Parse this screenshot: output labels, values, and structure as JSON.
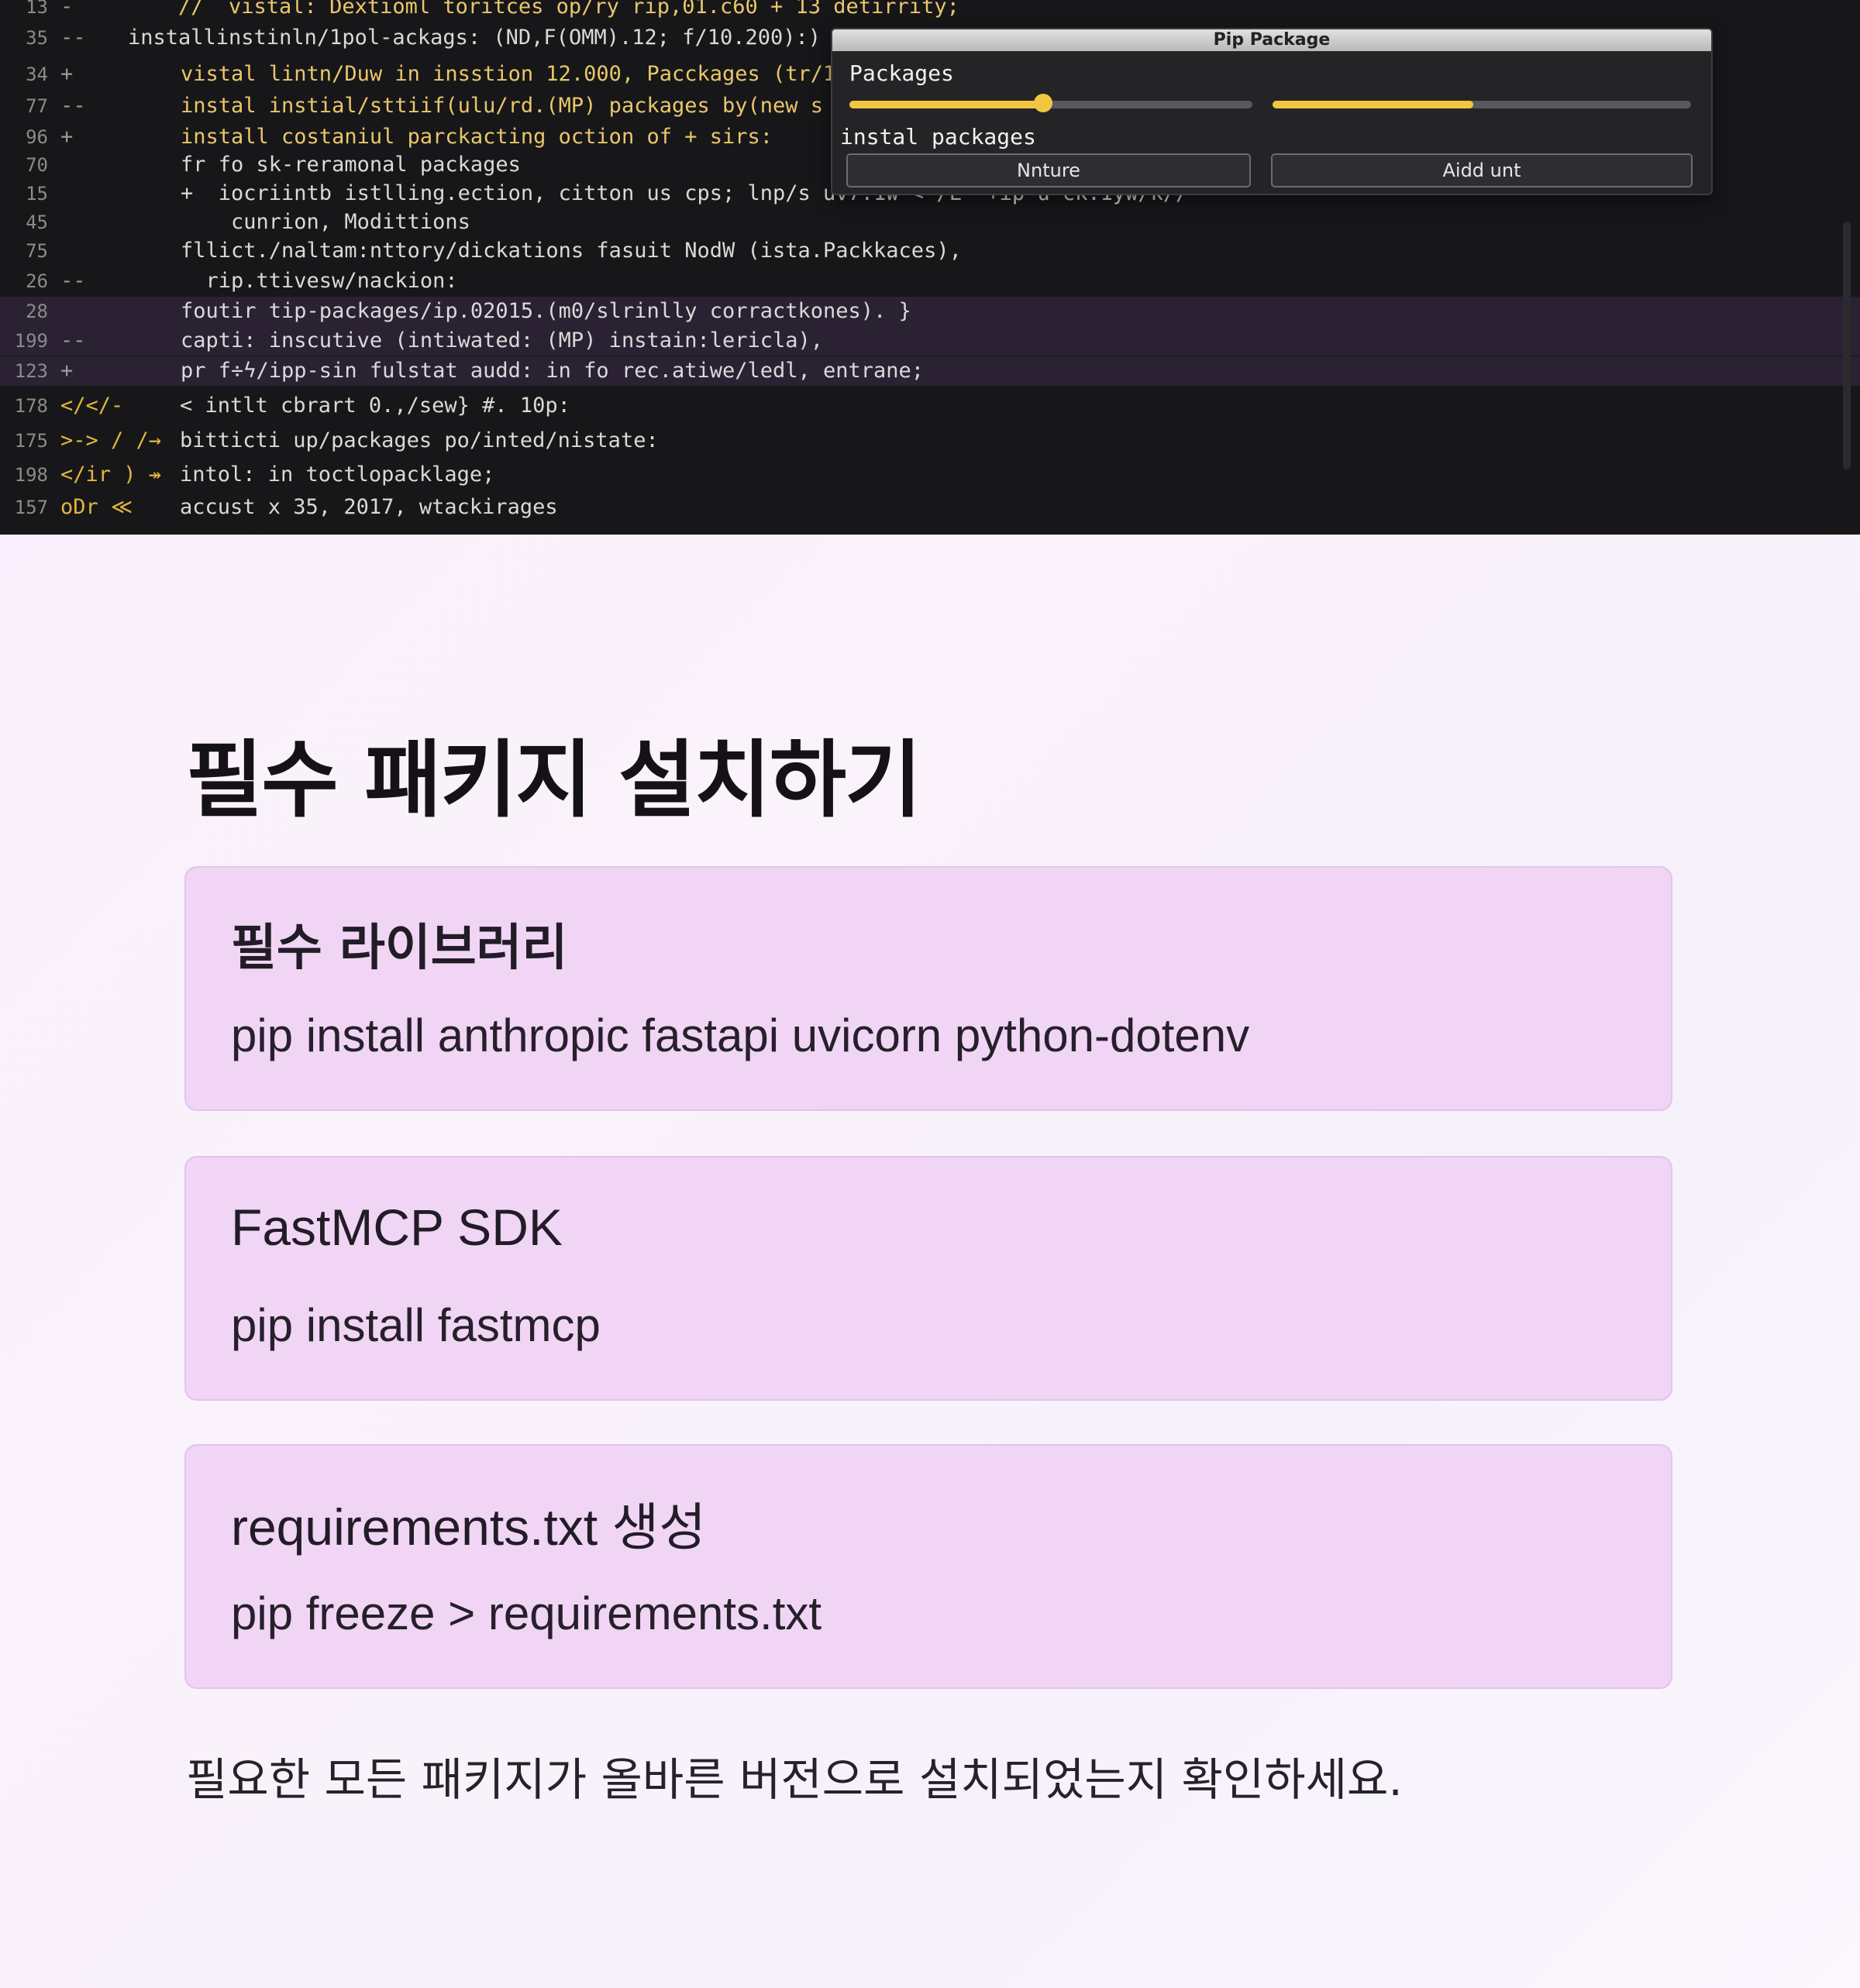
{
  "editor": {
    "lines": [
      {
        "num": "13",
        "gutter": "-",
        "text": "//  vistal: Dextioml toritces op/ry rip,01.c60 + 13 detirrity;",
        "style": "yl"
      },
      {
        "num": "35",
        "gutter": "--",
        "text": "installinstinln/1pol-ackags: (ND,F(OMM).12; f/10.200):)",
        "style": ""
      },
      {
        "num": "34",
        "gutter": "+",
        "text": "vistal lintn/Duw in insstion 12.000, Pacckages (tr/1",
        "style": "yl"
      },
      {
        "num": "77",
        "gutter": "--",
        "text": "instal instial/sttiif(ulu/rd.(MP) packages by(new s",
        "style": "yl"
      },
      {
        "num": "96",
        "gutter": "+",
        "text": "install costaniul parckacting oction of + sirs:",
        "style": "yl"
      },
      {
        "num": "70",
        "gutter": "",
        "text": "fr fo sk-reramonal packages",
        "style": ""
      },
      {
        "num": "15",
        "gutter": "",
        "text": "+  iocriintb istlling.ection, citton us cps; lnp/s uv7.1w <-/L  +ip u ck.1yw/k//",
        "style": ""
      },
      {
        "num": "45",
        "gutter": "",
        "text": "    cunrion, Modittions",
        "style": ""
      },
      {
        "num": "75",
        "gutter": "",
        "text": "fllict./naltam:nttory/dickations fasuit NodW (ista.Packkaces),",
        "style": ""
      },
      {
        "num": "26",
        "gutter": "--",
        "text": "  rip.ttivesw/nackion:",
        "style": ""
      },
      {
        "num": "28",
        "gutter": "",
        "text": "foutir tip-packages/ip.02015.(m0/slrinlly corractkones). }",
        "style": "hl"
      },
      {
        "num": "199",
        "gutter": "--",
        "text": "capti: inscutive (intiwated: (MP) instain:lericla),",
        "style": "hl"
      },
      {
        "num": "123",
        "gutter": "+",
        "text": "pr f÷ϟ/ipp-sin fulstat audd: in fo rec.atiwe/ledl, entrane;",
        "style": "hl"
      },
      {
        "num": "178",
        "gutter": "</</-",
        "text": "< intlt cbrart 0.,/sew} #. 10p:",
        "style": ""
      },
      {
        "num": "175",
        "gutter": ">-> / /→",
        "text": "bitticti up/packages po/inted/nistate:",
        "style": ""
      },
      {
        "num": "198",
        "gutter": "</ir ) ↠",
        "text": "intol: in toctlopacklage;",
        "style": ""
      },
      {
        "num": "157",
        "gutter": "oDr ≪",
        "text": "accust x 35, 2017, wtackirages",
        "style": ""
      }
    ]
  },
  "dialog": {
    "title": "Pip Package",
    "packages_label": "Packages",
    "install_label": "instal packages",
    "slider1_value": 0.48,
    "slider2_value": 0.48,
    "button_left": "Nnture",
    "button_right": "Aidd unt"
  },
  "content": {
    "heading": "필수 패키지 설치하기",
    "cards": [
      {
        "title": "필수 라이브러리",
        "command": "pip install anthropic fastapi uvicorn python-dotenv"
      },
      {
        "title": "FastMCP SDK",
        "command": "pip install fastmcp"
      },
      {
        "title": "requirements.txt 생성",
        "command": "pip freeze > requirements.txt"
      }
    ],
    "footnote": "필요한 모든 패키지가 올바른 버전으로 설치되었는지 확인하세요."
  },
  "colors": {
    "editor_bg": "#17171a",
    "accent_yellow": "#f2c740",
    "card_bg": "#f0d5f5",
    "heading_text": "#151217"
  }
}
